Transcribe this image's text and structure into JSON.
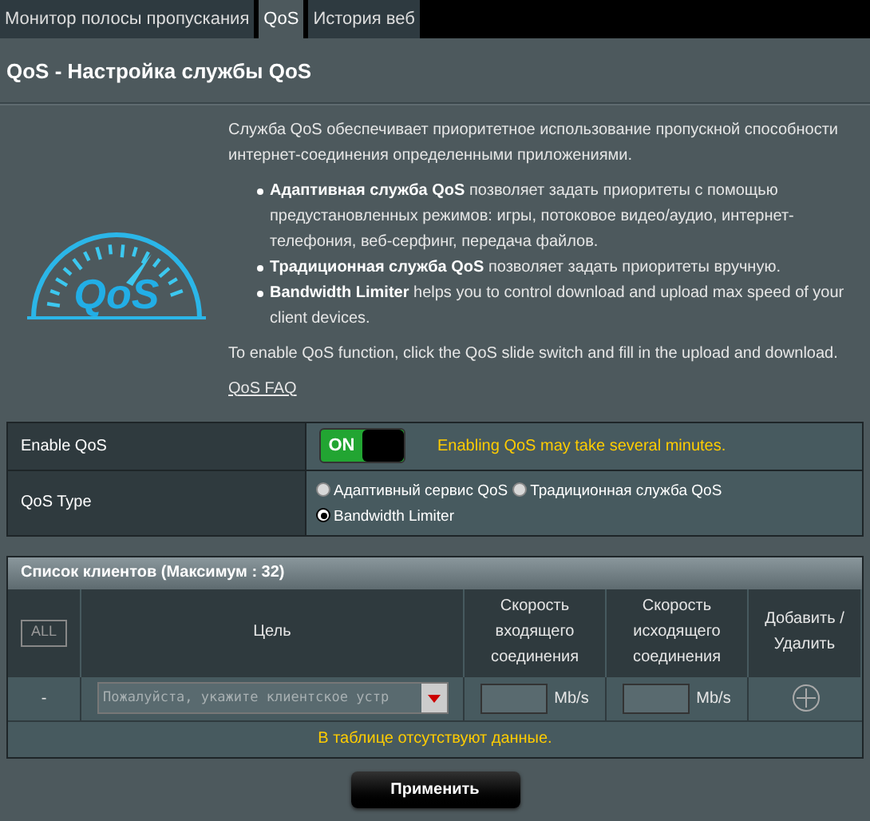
{
  "tabs": [
    {
      "label": "Монитор полосы пропускания",
      "selected": false
    },
    {
      "label": "QoS",
      "selected": true
    },
    {
      "label": "История веб",
      "selected": false
    }
  ],
  "title": "QoS - Настройка службы QoS",
  "logo_text": "QoS",
  "intro": {
    "paragraph": "Служба QoS обеспечивает приоритетное использование пропускной способности интернет-соединения определенными приложениями.",
    "bullets": [
      "**Адаптивная служба QoS** позволяет задать приоритеты с помощью предустановленных режимов: игры, потоковое видео/аудио, интернет-телефония, веб-серфинг, передача файлов.",
      "**Традиционная служба QoS** позволяет задать приоритеты вручную.",
      "**Bandwidth Limiter** helps you to control download and upload max speed of your client devices."
    ],
    "note": "To enable QoS function, click the QoS slide switch and fill in the upload and download.",
    "faq_link": "QoS FAQ"
  },
  "settings": {
    "enable_qos": {
      "label": "Enable QoS",
      "on": true,
      "switch_label": "ON",
      "hint": "Enabling QoS may take several minutes."
    },
    "qos_type": {
      "label": "QoS Type",
      "options": [
        {
          "label": "Адаптивный сервис QoS",
          "selected": false
        },
        {
          "label": "Традиционная служба QoS",
          "selected": false
        },
        {
          "label": "Bandwidth Limiter",
          "selected": true
        }
      ]
    }
  },
  "client_list": {
    "title": "Список клиентов (Максимум : 32)",
    "all_button": "ALL",
    "columns": [
      "Цель",
      "Скорость входящего соединения",
      "Скорость исходящего соединения",
      "Добавить / Удалить"
    ],
    "row": {
      "index": "-",
      "target_placeholder": "Пожалуйста, укажите клиентское устр",
      "download_unit": "Mb/s",
      "upload_unit": "Mb/s"
    },
    "empty_message": "В таблице отсутствуют данные."
  },
  "apply_button": "Применить"
}
